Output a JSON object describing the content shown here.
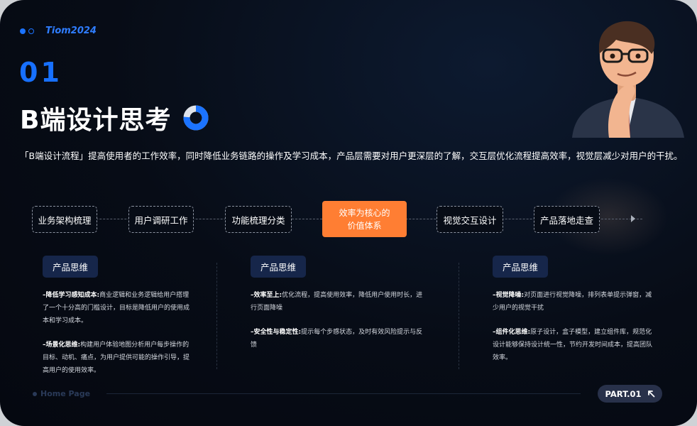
{
  "brand": {
    "name": "Tiom2024"
  },
  "section": {
    "number": "01"
  },
  "title": "B端设计思考",
  "intro": "「B端设计流程」提高使用者的工作效率，同时降低业务链路的操作及学习成本，产品层需要对用户更深层的了解，交互层优化流程提高效率，视觉层减少对用户的干扰。",
  "flow": {
    "steps": [
      {
        "label": "业务架构梳理"
      },
      {
        "label": "用户调研工作"
      },
      {
        "label": "功能梳理分类"
      },
      {
        "label_line1": "效率为核心的",
        "label_line2": "价值体系"
      },
      {
        "label": "视觉交互设计"
      },
      {
        "label": "产品落地走查"
      }
    ],
    "highlight_color": "#ff7e33"
  },
  "columns": [
    {
      "tag": "产品思维",
      "items": [
        {
          "title": "–降低学习感知成本:",
          "text": "商业逻辑和业务逻辑给用户搭理了一个十分高的门槛设计，目标是降低用户的使用成本和学习成本。"
        },
        {
          "title": "–场景化思维:",
          "text": "构建用户体验地图分析用户每步操作的目标、动机、痛点，为用户提供可能的操作引导，提高用户的使用效率。"
        }
      ]
    },
    {
      "tag": "产品思维",
      "items": [
        {
          "title": "–效率至上:",
          "text": "优化流程，提高使用效率，降低用户使用时长，进行页面降噪"
        },
        {
          "title": "–安全性与稳定性:",
          "text": "提示每个步感状态，及时有效风险提示与反馈"
        }
      ]
    },
    {
      "tag": "产品思维",
      "items": [
        {
          "title": "–视觉降噪:",
          "text": "对页面进行视觉降噪，排列表单提示弹窗，减少用户的视觉干扰"
        },
        {
          "title": "–组件化思维:",
          "text": "原子设计，盒子模型，建立组件库，规范化设计能够保持设计统一性，节约开发时间成本，提高团队效率。"
        }
      ]
    }
  ],
  "footer": {
    "home": "Home Page",
    "part": "PART.01"
  },
  "colors": {
    "accent_blue": "#1b73ff",
    "accent_orange": "#ff7e33",
    "background": "#070c16"
  },
  "icons": [
    "brand-dots-icon",
    "donut-chart-icon",
    "avatar-illustration",
    "flow-arrow-icon",
    "arrow-up-left-icon"
  ]
}
